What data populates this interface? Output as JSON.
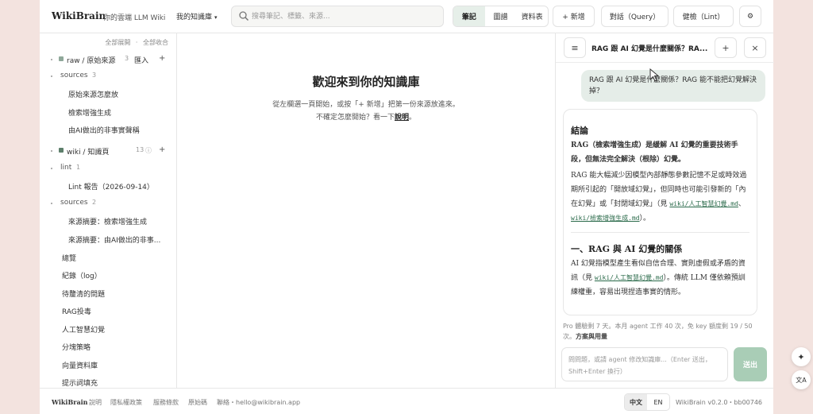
{
  "header": {
    "brand": "WikiBrain",
    "tagline": "你的雲端 LLM Wiki",
    "kb_select": "我的知識庫",
    "search_placeholder": "搜尋筆記、標籤、來源...",
    "view_tabs": [
      {
        "label": "筆記",
        "active": true
      },
      {
        "label": "圖譜",
        "active": false
      },
      {
        "label": "資料表",
        "active": false
      }
    ],
    "new_button": "+ 新增",
    "query_button": "對話（Query）",
    "lint_button": "健檢（Lint）",
    "settings_icon": "⚙"
  },
  "sidebar": {
    "expand_all": "全部展開",
    "collapse_all": "全部收合",
    "raw_section": {
      "label": "raw / 原始來源",
      "count": "3",
      "import": "匯入",
      "add": "+"
    },
    "raw_sources": {
      "label": "sources",
      "count": "3"
    },
    "raw_items": [
      "原始來源怎麼放",
      "檢索增強生成",
      "由AI做出的非事實聲稱"
    ],
    "wiki_section": {
      "label": "wiki / 知識頁",
      "count": "13",
      "info": "ⓘ",
      "add": "+"
    },
    "lint_group": {
      "label": "lint",
      "count": "1"
    },
    "lint_items": [
      "Lint 報告（2026-09-14）"
    ],
    "wiki_sources": {
      "label": "sources",
      "count": "2"
    },
    "wiki_source_items": [
      "來源摘要：檢索增強生成",
      "來源摘要：由AI做出的非事..."
    ],
    "pages": [
      "總覽",
      "紀錄（log）",
      "待釐清的問題",
      "RAG投毒",
      "人工智慧幻覺",
      "分塊策略",
      "向量資料庫",
      "提示詞填充"
    ]
  },
  "main": {
    "title": "歡迎來到你的知識庫",
    "line1": "從左欄選一頁開始，或按「+ 新增」把第一份來源放進來。",
    "line2_prefix": "不確定怎麼開始？看一下",
    "line2_link": "說明",
    "line2_suffix": "。"
  },
  "panel": {
    "menu_icon": "≡",
    "title": "RAG 跟 AI 幻覺是什麼關係？RA...",
    "add_icon": "+",
    "close_icon": "×",
    "user_message": "RAG 跟 AI 幻覺是什麼關係？RAG 能不能把幻覺解決掉？",
    "answer": {
      "h1": "結論",
      "p1": "RAG（檢索增強生成）是緩解 AI 幻覺的重要技術手段，但無法完全解決（根除）幻覺。",
      "p2_a": "RAG 能大幅減少因模型內部靜態參數記憶不足或時效過期所引起的「開放域幻覺」，但同時也可能引發新的「內在幻覺」或「封閉域幻覺」（見 ",
      "p2_link1": "wiki/人工智慧幻覺.md",
      "p2_sep": "、",
      "p2_link2": "wiki/檢索增強生成.md",
      "p2_b": "）。",
      "h2": "一、RAG 與 AI 幻覺的關係",
      "p3_a": "AI 幻覺指模型產生看似自信合理、實則虛假或矛盾的資訊（見 ",
      "p3_link": "wiki/人工智慧幻覺.md",
      "p3_b": "）。傳統 LLM 僅依賴預訓練權重，容易出現捏造事實的情形。"
    },
    "quota_text": "Pro 體驗剩 7 天。本月 agent 工作 40 次，免 key 額度剩 19 / 50 次。",
    "quota_link": "方案與用量",
    "composer_placeholder": "問問題，或請 agent 修改知識庫...（Enter 送出，Shift+Enter 換行）",
    "send": "送出"
  },
  "footer": {
    "brand": "WikiBrain",
    "links": [
      "說明",
      "隱私權政策",
      "服務條款",
      "原始碼"
    ],
    "contact": "聯絡・hello@wikibrain.app",
    "lang_zh": "中文",
    "lang_en": "EN",
    "version": "WikiBrain v0.2.0・bb00746"
  },
  "floating": {
    "ai_icon": "✦",
    "translate_icon": "文A"
  },
  "colors": {
    "accent": "#5a8a6e",
    "raw_square": "#8fa89a",
    "wiki_square": "#5d7f6b",
    "send_bg": "#a9cdb6",
    "active_tab": "#e6efe9"
  }
}
